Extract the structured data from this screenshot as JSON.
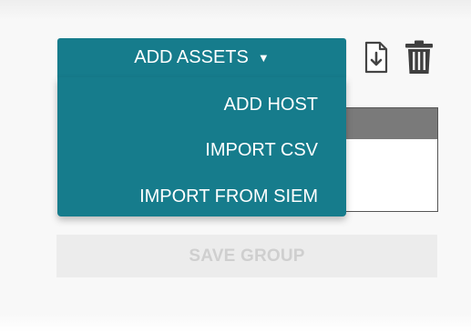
{
  "toolbar": {
    "add_assets_label": "ADD ASSETS",
    "caret_glyph": "▼",
    "export_icon": "download-file-icon",
    "delete_icon": "trash-icon"
  },
  "dropdown": {
    "items": [
      {
        "label": "ADD HOST"
      },
      {
        "label": "IMPORT CSV"
      },
      {
        "label": "IMPORT FROM SIEM"
      }
    ]
  },
  "footer": {
    "save_group_label": "SAVE GROUP"
  },
  "colors": {
    "accent": "#167c8c",
    "table_header": "#7a7a7a",
    "disabled_bg": "#ececec",
    "disabled_text": "#cfcfcf"
  }
}
